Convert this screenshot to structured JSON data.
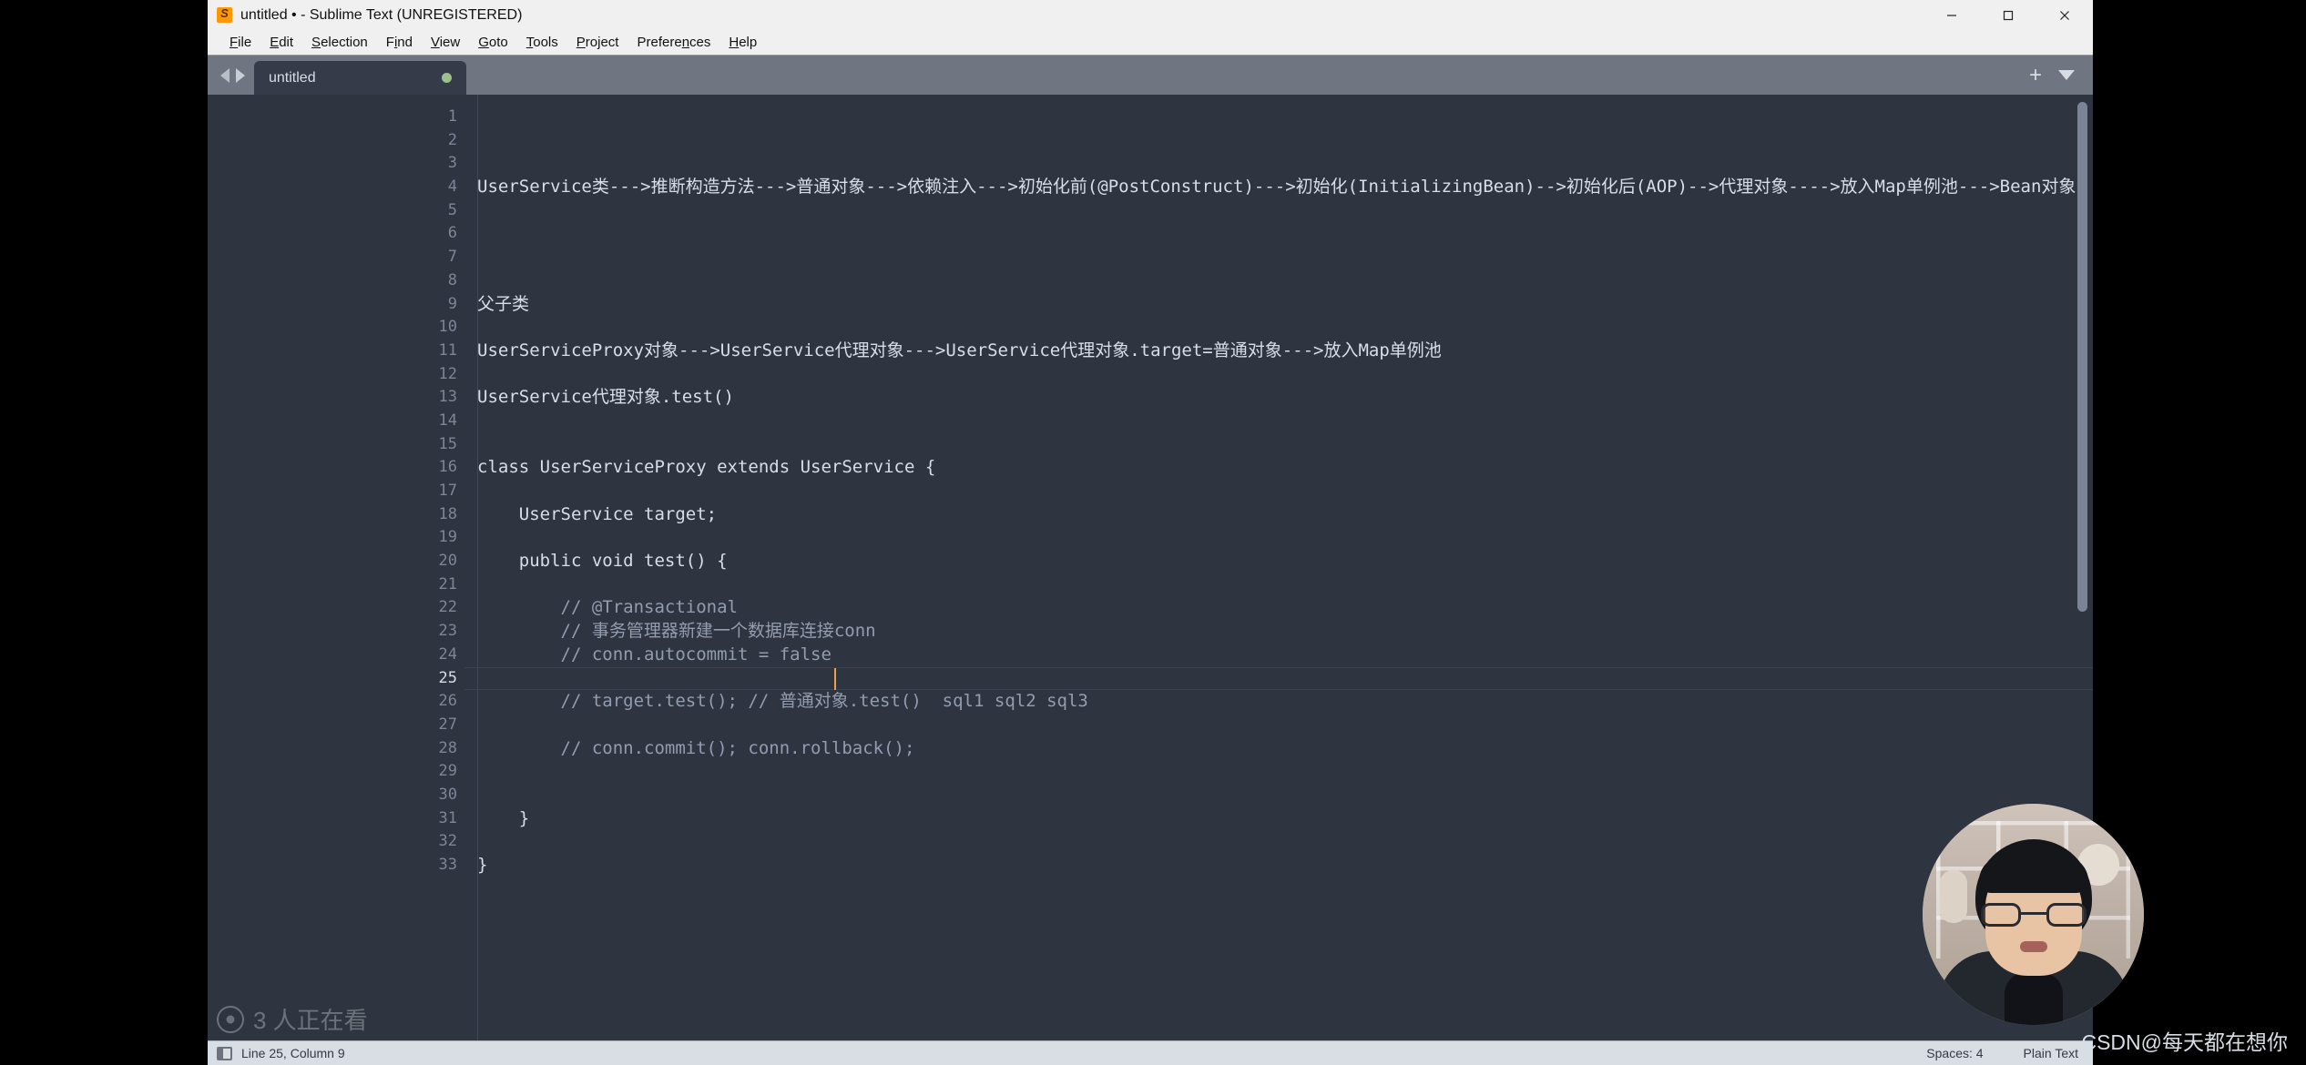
{
  "window": {
    "title": "untitled • - Sublime Text (UNREGISTERED)",
    "app_icon": "sublime-text-icon",
    "minimize": "minimize-icon",
    "maximize": "maximize-icon",
    "close": "close-icon"
  },
  "menubar": {
    "items": [
      {
        "label": "File",
        "mnemonic": "F"
      },
      {
        "label": "Edit",
        "mnemonic": "E"
      },
      {
        "label": "Selection",
        "mnemonic": "S"
      },
      {
        "label": "Find",
        "mnemonic": "i"
      },
      {
        "label": "View",
        "mnemonic": "V"
      },
      {
        "label": "Goto",
        "mnemonic": "G"
      },
      {
        "label": "Tools",
        "mnemonic": "T"
      },
      {
        "label": "Project",
        "mnemonic": "P"
      },
      {
        "label": "Preferences",
        "mnemonic": "n"
      },
      {
        "label": "Help",
        "mnemonic": "H"
      }
    ]
  },
  "tabbar": {
    "prev_icon": "arrow-left-icon",
    "next_icon": "arrow-right-icon",
    "new_tab_icon": "plus-icon",
    "tab_menu_icon": "chevron-down-icon",
    "tabs": [
      {
        "label": "untitled",
        "dirty": true
      }
    ]
  },
  "editor": {
    "active_line": 25,
    "caret_column": 9,
    "lines": [
      {
        "n": 1,
        "text": "",
        "kind": "plain"
      },
      {
        "n": 2,
        "text": "",
        "kind": "plain"
      },
      {
        "n": 3,
        "text": "",
        "kind": "plain"
      },
      {
        "n": 4,
        "text": "UserService类--->推断构造方法--->普通对象--->依赖注入--->初始化前(@PostConstruct)--->初始化(InitializingBean)-->初始化后(AOP)-->代理对象---->放入Map单例池--->Bean对象",
        "kind": "plain"
      },
      {
        "n": 5,
        "text": "",
        "kind": "plain"
      },
      {
        "n": 6,
        "text": "",
        "kind": "plain"
      },
      {
        "n": 7,
        "text": "",
        "kind": "plain"
      },
      {
        "n": 8,
        "text": "",
        "kind": "plain"
      },
      {
        "n": 9,
        "text": "父子类",
        "kind": "plain"
      },
      {
        "n": 10,
        "text": "",
        "kind": "plain"
      },
      {
        "n": 11,
        "text": "UserServiceProxy对象--->UserService代理对象--->UserService代理对象.target=普通对象--->放入Map单例池",
        "kind": "plain"
      },
      {
        "n": 12,
        "text": "",
        "kind": "plain"
      },
      {
        "n": 13,
        "text": "UserService代理对象.test()",
        "kind": "plain"
      },
      {
        "n": 14,
        "text": "",
        "kind": "plain"
      },
      {
        "n": 15,
        "text": "",
        "kind": "plain"
      },
      {
        "n": 16,
        "text": "class UserServiceProxy extends UserService {",
        "kind": "plain"
      },
      {
        "n": 17,
        "text": "",
        "kind": "plain"
      },
      {
        "n": 18,
        "text": "    UserService target;",
        "kind": "plain"
      },
      {
        "n": 19,
        "text": "",
        "kind": "plain"
      },
      {
        "n": 20,
        "text": "    public void test() {",
        "kind": "plain"
      },
      {
        "n": 21,
        "text": "",
        "kind": "plain"
      },
      {
        "n": 22,
        "text": "        // @Transactional",
        "kind": "comment"
      },
      {
        "n": 23,
        "text": "        // 事务管理器新建一个数据库连接conn",
        "kind": "comment"
      },
      {
        "n": 24,
        "text": "        // conn.autocommit = false",
        "kind": "comment"
      },
      {
        "n": 25,
        "text": "        ",
        "kind": "plain"
      },
      {
        "n": 26,
        "text": "        // target.test(); // 普通对象.test()  sql1 sql2 sql3",
        "kind": "comment"
      },
      {
        "n": 27,
        "text": "",
        "kind": "plain"
      },
      {
        "n": 28,
        "text": "        // conn.commit(); conn.rollback();",
        "kind": "comment"
      },
      {
        "n": 29,
        "text": "",
        "kind": "plain"
      },
      {
        "n": 30,
        "text": "",
        "kind": "plain"
      },
      {
        "n": 31,
        "text": "    }",
        "kind": "plain"
      },
      {
        "n": 32,
        "text": "",
        "kind": "plain"
      },
      {
        "n": 33,
        "text": "}",
        "kind": "plain"
      }
    ]
  },
  "statusbar": {
    "sidebar_icon": "sidebar-toggle-icon",
    "cursor_position": "Line 25, Column 9",
    "indentation": "Spaces: 4",
    "syntax": "Plain Text"
  },
  "overlays": {
    "viewer_count": "3 人正在看",
    "viewer_icon": "eye-icon",
    "webcam": "webcam-circle-overlay",
    "csdn_watermark": "CSDN@每天都在想你"
  },
  "colors": {
    "editor_bg": "#2e3440",
    "tabbar_bg": "#6f7581",
    "tab_active_bg": "#353b48",
    "text": "#d8dee9",
    "comment": "#939db0",
    "caret": "#f0a04b",
    "dirty_dot": "#9dc08c",
    "chrome_bg": "#f0f0f0",
    "statusbar_bg": "#d9dde4"
  }
}
